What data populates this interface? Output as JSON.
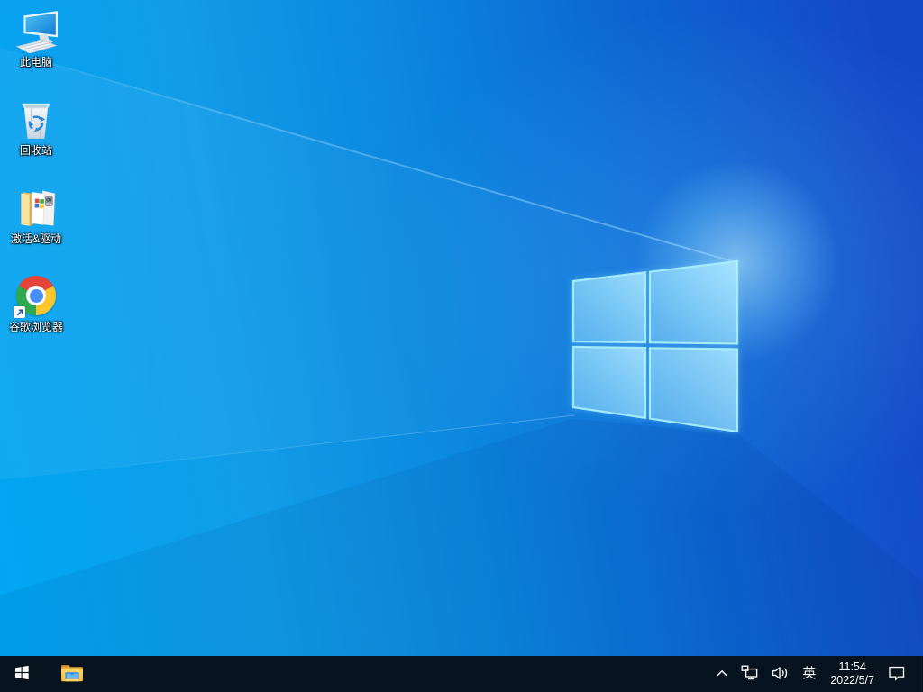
{
  "desktop": {
    "icons": [
      {
        "id": "this-pc",
        "label": "此电脑",
        "icon": "this-pc-icon"
      },
      {
        "id": "recycle-bin",
        "label": "回收站",
        "icon": "recycle-bin-icon"
      },
      {
        "id": "activation-drivers",
        "label": "激活&驱动",
        "icon": "open-folder-icon"
      },
      {
        "id": "chrome",
        "label": "谷歌浏览器",
        "icon": "chrome-icon"
      }
    ]
  },
  "wallpaper": {
    "description": "windows-10-light-hero",
    "colors": {
      "bright_left": "#00a7f3",
      "deep_right": "#1545c6",
      "logo_edge": "#a8eefc"
    }
  },
  "taskbar": {
    "background": "#07141f",
    "left_icons": [
      "start-icon",
      "file-explorer-icon"
    ],
    "tray": {
      "hidden_icons": "chevron-up-icon",
      "network": "ethernet-icon",
      "volume": "speaker-icon",
      "input_method": "英",
      "time": "11:54",
      "date": "2022/5/7",
      "action_center": "notification-icon"
    }
  }
}
